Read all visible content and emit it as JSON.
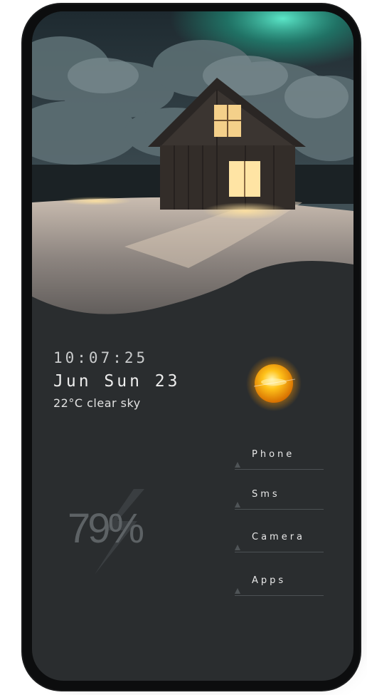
{
  "clock": {
    "time": "10:07:25",
    "date": "Jun Sun 23",
    "weather": "22°C  clear sky"
  },
  "weather_icon": "sun-icon",
  "battery": {
    "level_text": "79%",
    "icon": "lightning-icon"
  },
  "apps": [
    {
      "label": "Phone"
    },
    {
      "label": "Sms"
    },
    {
      "label": "Camera"
    },
    {
      "label": "Apps"
    }
  ],
  "colors": {
    "background": "#2a2d2f",
    "accent_sun": "#f5a800",
    "aurora": "#3fd4b4"
  }
}
